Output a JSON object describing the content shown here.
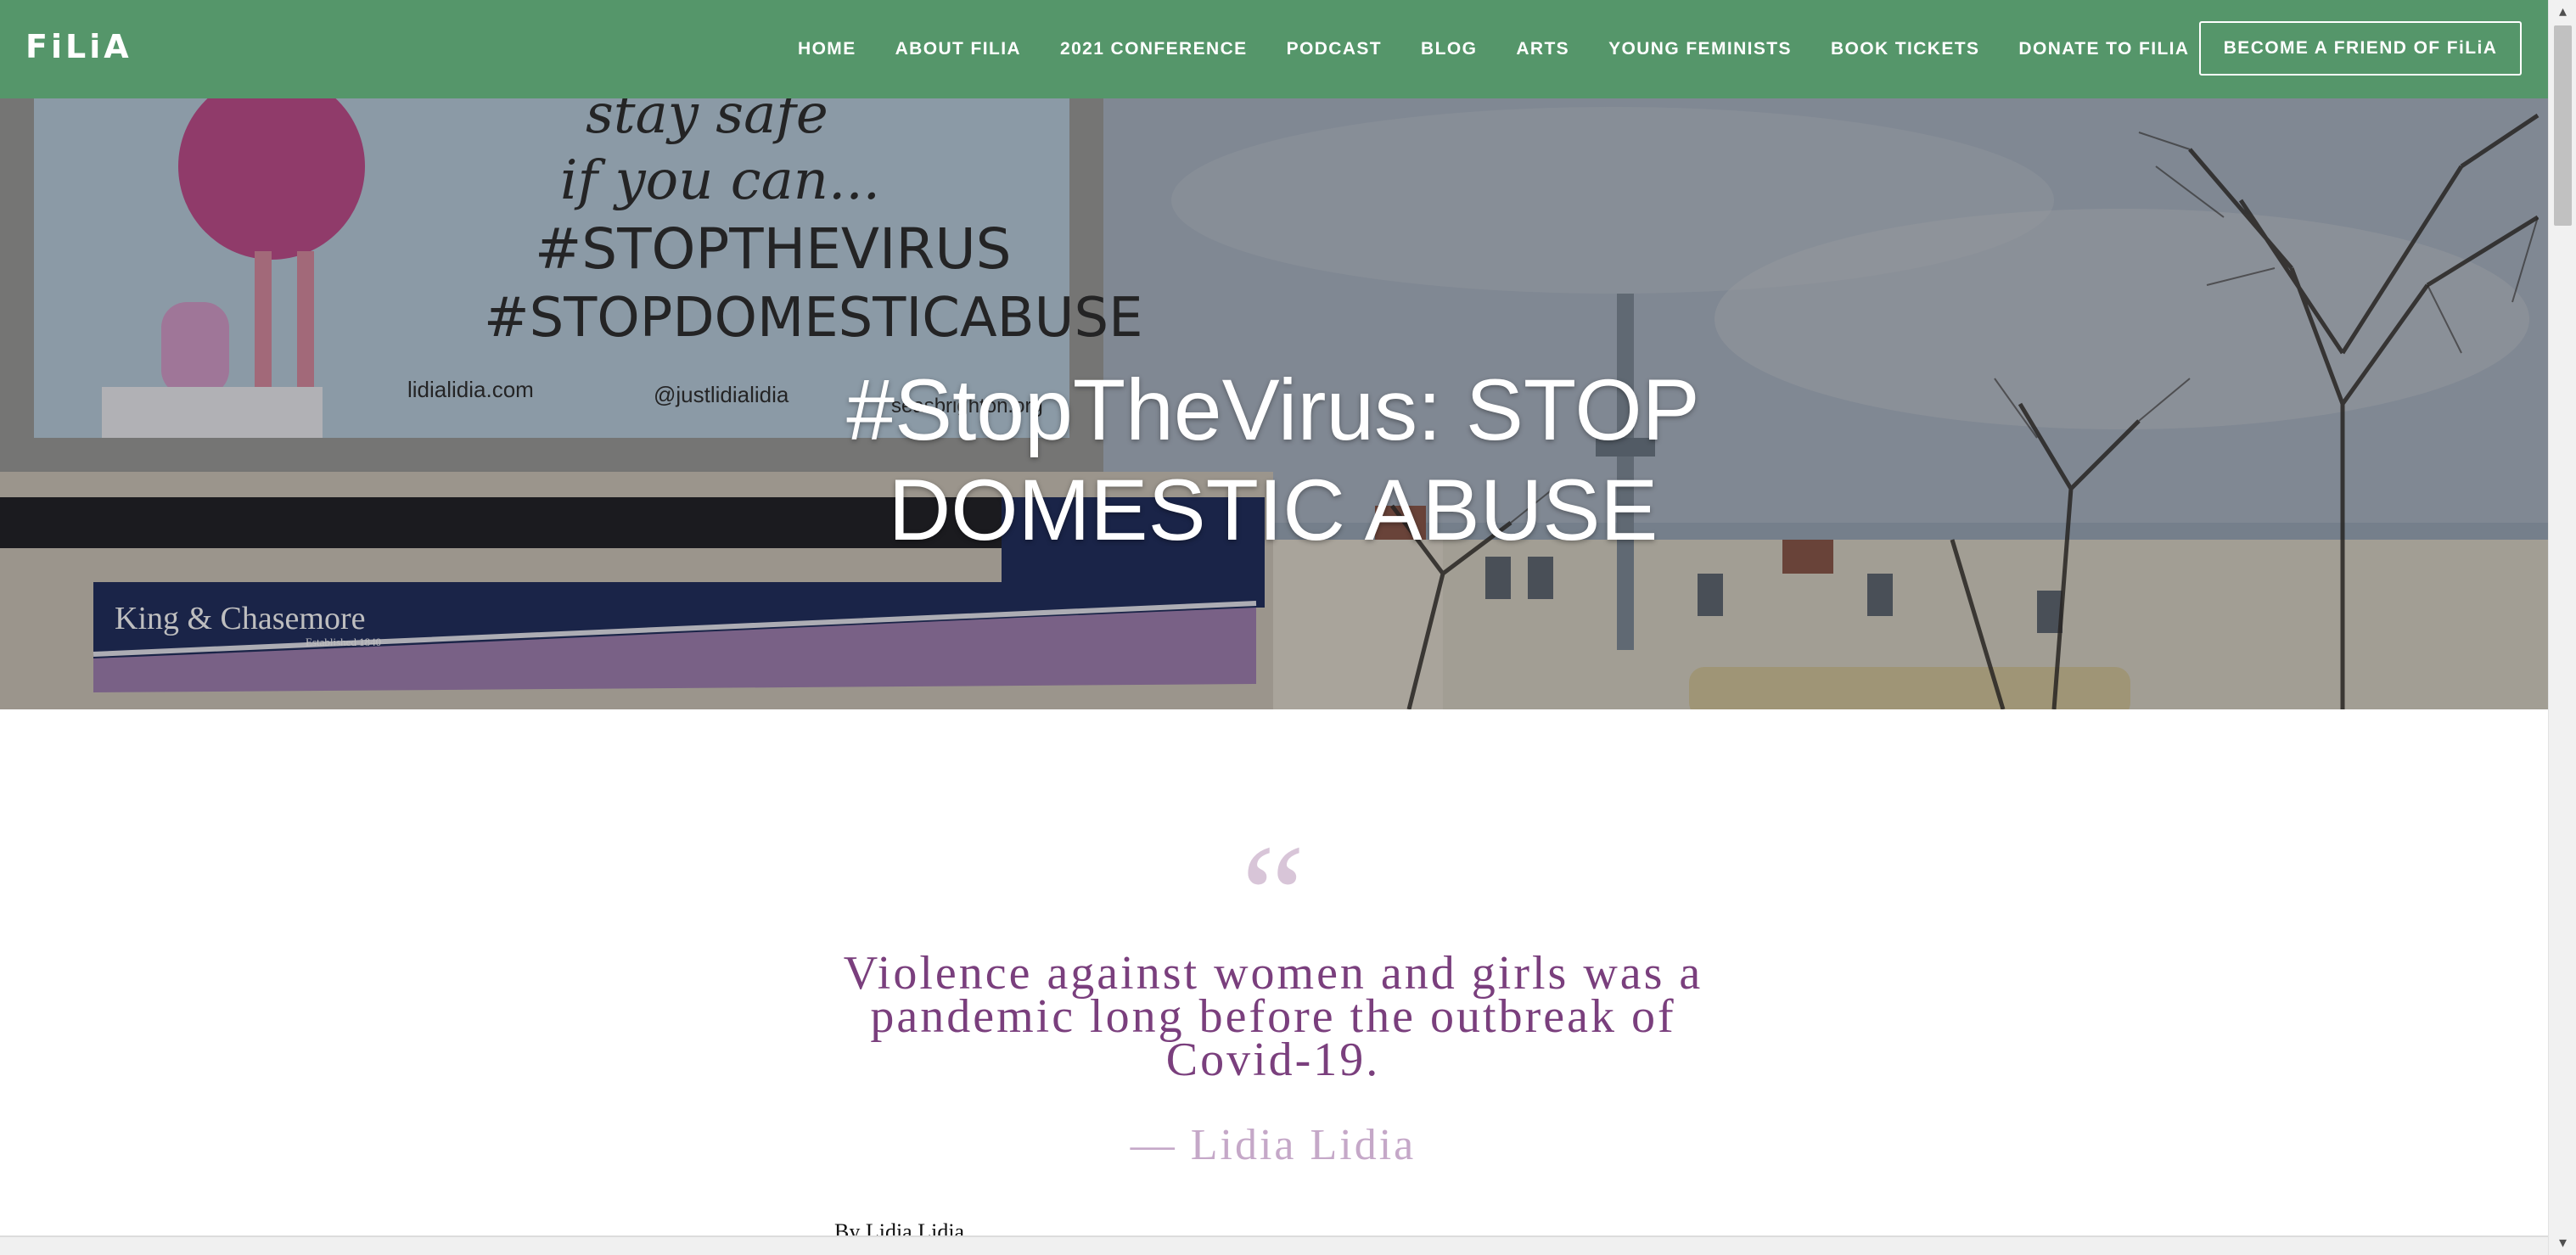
{
  "header": {
    "logo": "FiLiA",
    "nav": [
      "HOME",
      "ABOUT FILIA",
      "2021 CONFERENCE",
      "PODCAST",
      "BLOG",
      "ARTS",
      "YOUNG FEMINISTS",
      "BOOK TICKETS",
      "DONATE TO FILIA"
    ],
    "cta": "BECOME A FRIEND OF FiLiA"
  },
  "hero": {
    "title": "#StopTheVirus: STOP DOMESTIC ABUSE",
    "billboard": {
      "line1": "stay safe",
      "line2": "if you can...",
      "line3": "#STOPTHEVIRUS",
      "line4": "#STOPDOMESTICABUSE",
      "credit1": "lidialidia.com",
      "credit2": "@justlidialidia",
      "credit3": "seasbrighton.org"
    },
    "shop_sign": {
      "name": "King & Chasemore",
      "established": "Established 1840"
    }
  },
  "quote": {
    "mark": "“",
    "text": "Violence against women and girls was a pandemic long before the outbreak of Covid-19.",
    "author": "— Lidia Lidia"
  },
  "byline": "By Lidia Lidia",
  "colors": {
    "header_bg": "#55966a",
    "quote_text": "#7a3f7d",
    "quote_mark": "#d8c5d8",
    "author": "#c5a8c8"
  }
}
